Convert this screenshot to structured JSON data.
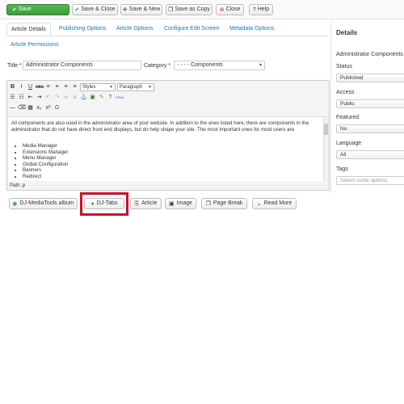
{
  "toolbar": {
    "save": "Save",
    "save_close": "Save & Close",
    "save_new": "Save & New",
    "save_copy": "Save as Copy",
    "close": "Close",
    "help": "Help"
  },
  "tabs": [
    "Article Details",
    "Publishing Options",
    "Article Options",
    "Configure Edit Screen",
    "Metadata Options",
    "Article Permissions"
  ],
  "form": {
    "title_label": "Title *",
    "title_value": "Administrator Components",
    "category_label": "Category *",
    "category_value": "- - - - Components"
  },
  "editor": {
    "styles": "Styles",
    "format": "Paragraph",
    "paragraph": "All components are also used in the administrator area of your website. In addition to the ones listed here, there are components in the administrator that do not have direct front end displays, but do help shape your site. The most important ones for most users are",
    "list": [
      "Media Manager",
      "Extensions Manager",
      "Menu Manager",
      "Global Configuration",
      "Banners",
      "Redirect"
    ],
    "path": "Path: p"
  },
  "buttons": {
    "dj_mediatools": "DJ-MediaTools album",
    "dj_tabs": "DJ-Tabs",
    "article": "Article",
    "image": "Image",
    "page_break": "Page Break",
    "read_more": "Read More"
  },
  "sidebar": {
    "title": "Details",
    "category_value": "Administrator Components",
    "status_label": "Status",
    "status_value": "Published",
    "access_label": "Access",
    "access_value": "Public",
    "featured_label": "Featured",
    "featured_value": "No",
    "language_label": "Language",
    "language_value": "All",
    "tags_label": "Tags",
    "tags_placeholder": "Select some options"
  }
}
